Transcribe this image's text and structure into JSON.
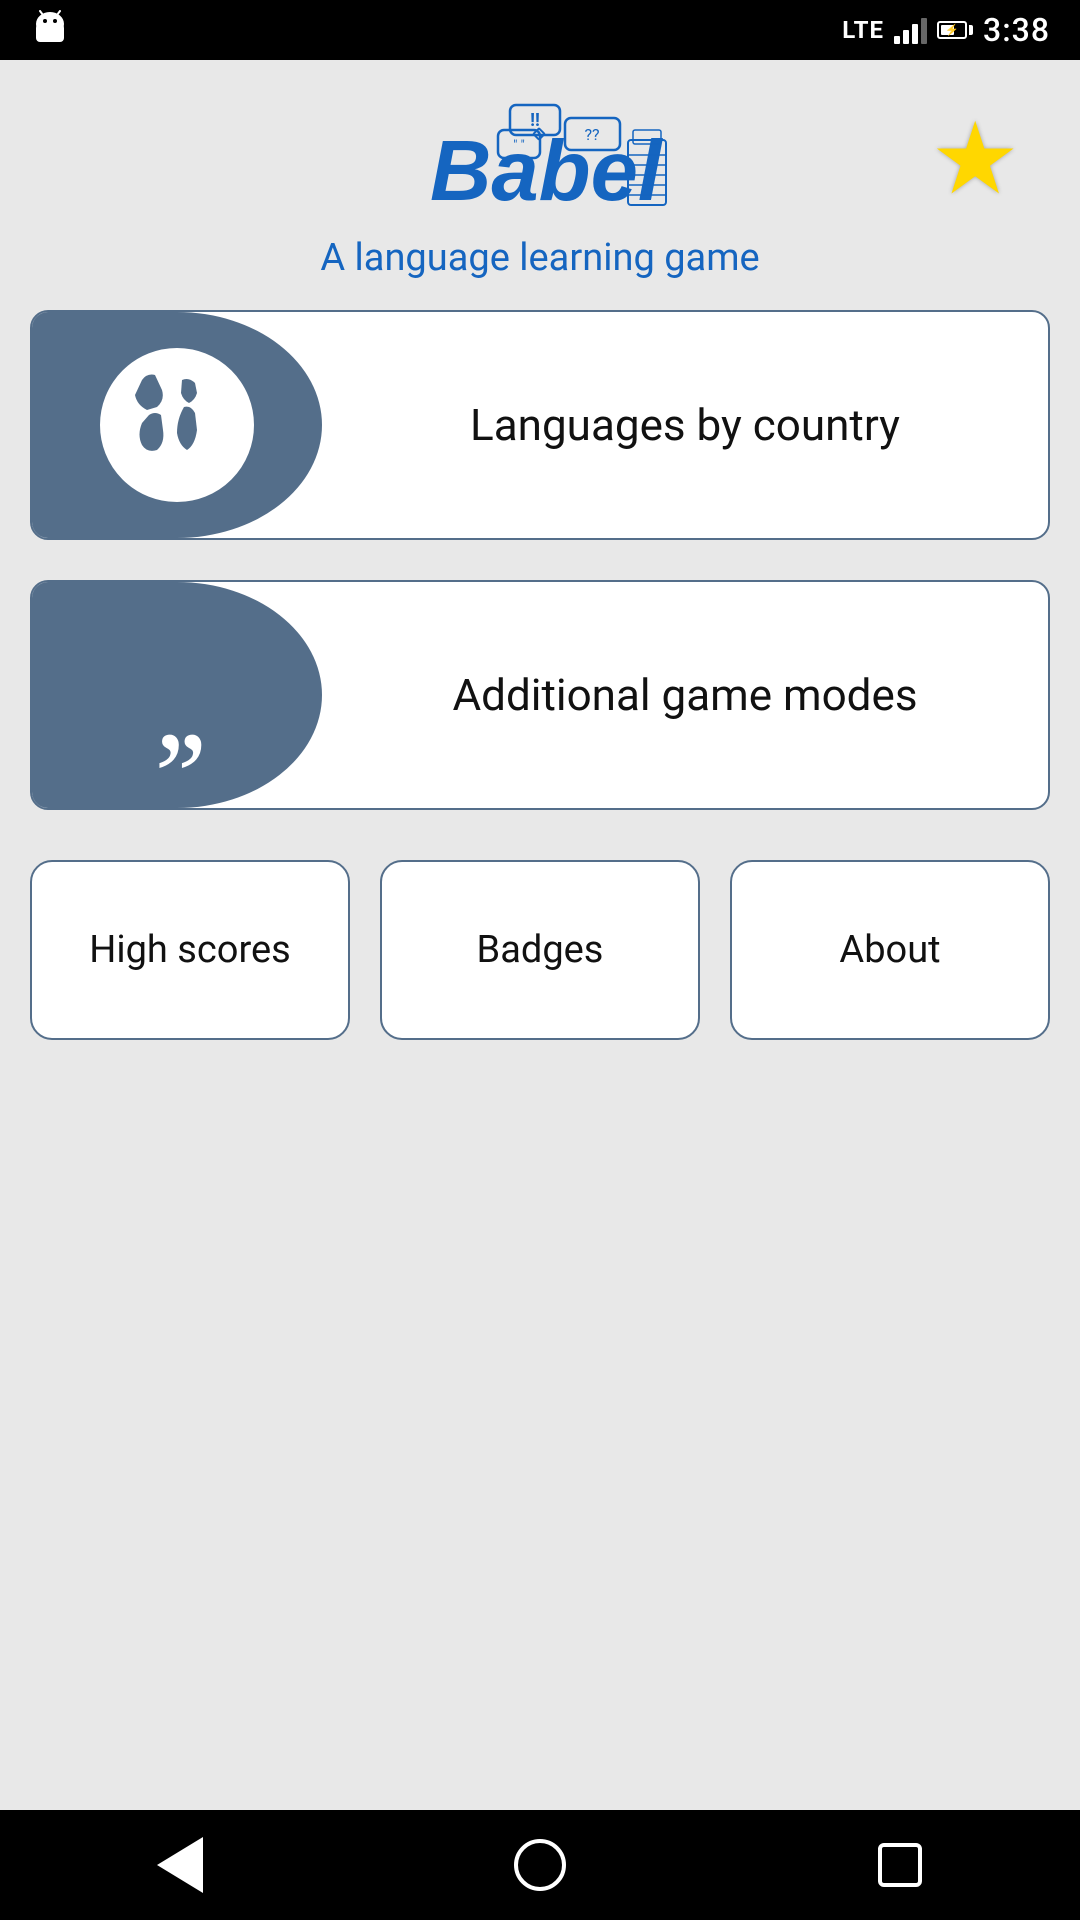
{
  "statusBar": {
    "time": "3:38",
    "lte": "LTE"
  },
  "header": {
    "subtitle": "A language learning game",
    "starIcon": "★"
  },
  "buttons": {
    "languagesByCountry": "Languages by country",
    "additionalGameModes": "Additional game modes"
  },
  "smallButtons": {
    "highScores": "High scores",
    "badges": "Badges",
    "about": "About"
  }
}
